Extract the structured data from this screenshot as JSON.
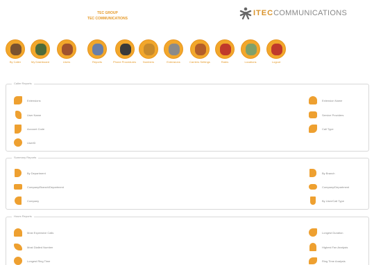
{
  "header": {
    "org_line1": "TEC GROUP",
    "org_line2": "TEC COMMUNICATIONS"
  },
  "logo": {
    "brand": "ITEC",
    "suffix": "COMMUNICATIONS"
  },
  "toolbar": [
    {
      "name": "by-caller",
      "label": "By Caller",
      "color": "#7a5230"
    },
    {
      "name": "my-dashboard",
      "label": "My Dashboard",
      "color": "#4d6b3a"
    },
    {
      "name": "users",
      "label": "Users",
      "color": "#a0522d"
    },
    {
      "name": "reports",
      "label": "Reports",
      "color": "#6a7fa8"
    },
    {
      "name": "phone-procedures",
      "label": "Phone Procedures",
      "color": "#3a3a3a"
    },
    {
      "name": "numbers",
      "label": "Numbers",
      "color": "#c78a2c"
    },
    {
      "name": "extensions",
      "label": "Extensions",
      "color": "#8a8a8a"
    },
    {
      "name": "carrier-settings",
      "label": "Carriers Settings",
      "color": "#b35e2a"
    },
    {
      "name": "rates",
      "label": "Rates",
      "color": "#c0392b"
    },
    {
      "name": "locations",
      "label": "Locations",
      "color": "#7fa06a"
    },
    {
      "name": "logout",
      "label": "Logout",
      "color": "#c0392b"
    }
  ],
  "panels": {
    "caller": {
      "title": "Caller Reports",
      "left": [
        "Extensions",
        "User Name",
        "Account Code",
        "UserID"
      ],
      "right": [
        "Extension Name",
        "Service Providers",
        "Call Type"
      ]
    },
    "summary": {
      "title": "Summary Reports",
      "left": [
        "By Department",
        "Company/Branch/Department",
        "Company"
      ],
      "right": [
        "By Branch",
        "Company/Department",
        "By User/Call Type"
      ]
    },
    "hours": {
      "title": "Hours Reports",
      "left": [
        "Most Expensive Calls",
        "Most Dialled Number",
        "Longest Ring Time"
      ],
      "right": [
        "Longest Duration",
        "Highest Fan Analysis",
        "Ring Time Analysis"
      ]
    }
  }
}
